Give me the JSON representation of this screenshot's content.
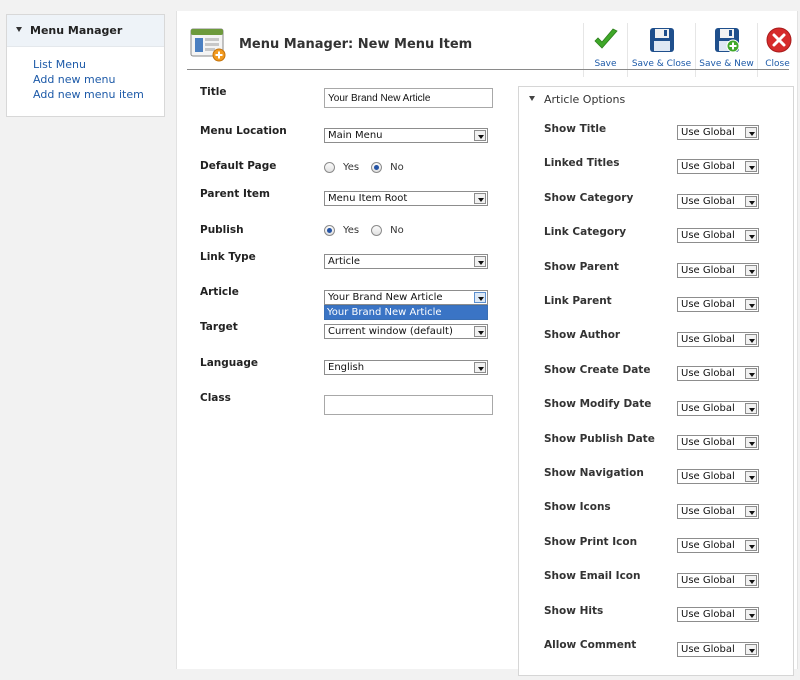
{
  "sidebar": {
    "title": "Menu Manager",
    "links": [
      "List Menu",
      "Add new menu",
      "Add new menu item"
    ]
  },
  "header": {
    "title": "Menu Manager: New Menu Item",
    "icon": "menu-item-add-icon"
  },
  "toolbar": {
    "save": "Save",
    "save_close": "Save & Close",
    "save_new": "Save & New",
    "close": "Close"
  },
  "form": {
    "title_label": "Title",
    "title_value": "Your Brand New Article",
    "menu_location_label": "Menu Location",
    "menu_location_value": "Main Menu",
    "default_page_label": "Default Page",
    "default_page_options": [
      "Yes",
      "No"
    ],
    "default_page_selected": "No",
    "parent_item_label": "Parent Item",
    "parent_item_value": "Menu Item Root",
    "publish_label": "Publish",
    "publish_options": [
      "Yes",
      "No"
    ],
    "publish_selected": "Yes",
    "link_type_label": "Link Type",
    "link_type_value": "Article",
    "article_label": "Article",
    "article_value": "Your Brand New Article",
    "article_dropdown_option": "Your Brand New Article",
    "target_label": "Target",
    "target_value": "Current window (default)",
    "language_label": "Language",
    "language_value": "English",
    "class_label": "Class",
    "class_value": ""
  },
  "article_options": {
    "title": "Article Options",
    "items": [
      {
        "label": "Show Title",
        "value": "Use Global"
      },
      {
        "label": "Linked Titles",
        "value": "Use Global"
      },
      {
        "label": "Show Category",
        "value": "Use Global"
      },
      {
        "label": "Link Category",
        "value": "Use Global"
      },
      {
        "label": "Show Parent",
        "value": "Use Global"
      },
      {
        "label": "Link Parent",
        "value": "Use Global"
      },
      {
        "label": "Show Author",
        "value": "Use Global"
      },
      {
        "label": "Show Create Date",
        "value": "Use Global"
      },
      {
        "label": "Show Modify Date",
        "value": "Use Global"
      },
      {
        "label": "Show Publish Date",
        "value": "Use Global"
      },
      {
        "label": "Show Navigation",
        "value": "Use Global"
      },
      {
        "label": "Show Icons",
        "value": "Use Global"
      },
      {
        "label": "Show Print Icon",
        "value": "Use Global"
      },
      {
        "label": "Show Email Icon",
        "value": "Use Global"
      },
      {
        "label": "Show Hits",
        "value": "Use Global"
      },
      {
        "label": "Allow Comment",
        "value": "Use Global"
      }
    ]
  },
  "colors": {
    "link": "#1d5aa8",
    "save_green": "#3fa829",
    "close_red": "#d62b2b",
    "selected_option": "#3a74c5"
  }
}
